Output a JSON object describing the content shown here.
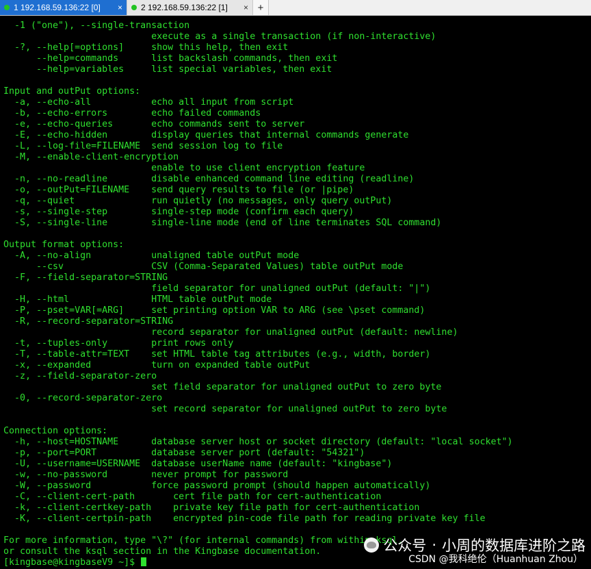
{
  "tabs": [
    {
      "label": "1 192.168.59.136:22 [0]",
      "active": true,
      "close": "×"
    },
    {
      "label": "2 192.168.59.136:22 [1]",
      "active": false,
      "close": "×"
    }
  ],
  "add_tab": "+",
  "terminal": {
    "lines": [
      "  -1 (\"one\"), --single-transaction",
      "                           execute as a single transaction (if non-interactive)",
      "  -?, --help[=options]     show this help, then exit",
      "      --help=commands      list backslash commands, then exit",
      "      --help=variables     list special variables, then exit",
      "",
      "Input and outPut options:",
      "  -a, --echo-all           echo all input from script",
      "  -b, --echo-errors        echo failed commands",
      "  -e, --echo-queries       echo commands sent to server",
      "  -E, --echo-hidden        display queries that internal commands generate",
      "  -L, --log-file=FILENAME  send session log to file",
      "  -M, --enable-client-encryption",
      "                           enable to use client encryption feature",
      "  -n, --no-readline        disable enhanced command line editing (readline)",
      "  -o, --outPut=FILENAME    send query results to file (or |pipe)",
      "  -q, --quiet              run quietly (no messages, only query outPut)",
      "  -s, --single-step        single-step mode (confirm each query)",
      "  -S, --single-line        single-line mode (end of line terminates SQL command)",
      "",
      "Output format options:",
      "  -A, --no-align           unaligned table outPut mode",
      "      --csv                CSV (Comma-Separated Values) table outPut mode",
      "  -F, --field-separator=STRING",
      "                           field separator for unaligned outPut (default: \"|\")",
      "  -H, --html               HTML table outPut mode",
      "  -P, --pset=VAR[=ARG]     set printing option VAR to ARG (see \\pset command)",
      "  -R, --record-separator=STRING",
      "                           record separator for unaligned outPut (default: newline)",
      "  -t, --tuples-only        print rows only",
      "  -T, --table-attr=TEXT    set HTML table tag attributes (e.g., width, border)",
      "  -x, --expanded           turn on expanded table outPut",
      "  -z, --field-separator-zero",
      "                           set field separator for unaligned outPut to zero byte",
      "  -0, --record-separator-zero",
      "                           set record separator for unaligned outPut to zero byte",
      "",
      "Connection options:",
      "  -h, --host=HOSTNAME      database server host or socket directory (default: \"local socket\")",
      "  -p, --port=PORT          database server port (default: \"54321\")",
      "  -U, --username=USERNAME  database userName name (default: \"kingbase\")",
      "  -w, --no-password        never prompt for password",
      "  -W, --password           force password prompt (should happen automatically)",
      "  -C, --client-cert-path       cert file path for cert-authentication",
      "  -k, --client-certkey-path    private key file path for cert-authentication",
      "  -K, --client-certpin-path    encrypted pin-code file path for reading private key file",
      "",
      "For more information, type \"\\?\" (for internal commands) from within ksql,",
      "or consult the ksql section in the Kingbase documentation."
    ],
    "prompt": "[kingbase@kingbaseV9 ~]$ "
  },
  "watermark": {
    "brand": "公众号",
    "separator": "·",
    "title": "小周的数据库进阶之路"
  },
  "credit": "CSDN @我科绝伦（Huanhuan Zhou）",
  "colors": {
    "terminal_fg": "#2fe02f",
    "terminal_bg": "#000000",
    "active_tab": "#1f6fd1"
  }
}
